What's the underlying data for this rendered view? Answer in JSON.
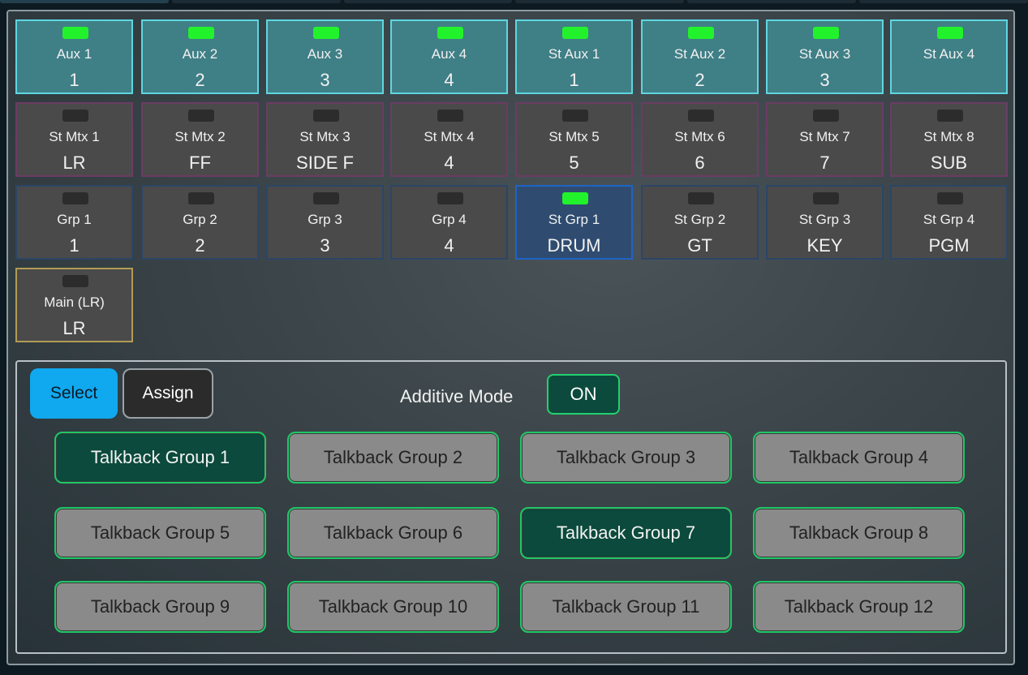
{
  "buses": {
    "aux": [
      {
        "name": "Aux 1",
        "value": "1",
        "active": true
      },
      {
        "name": "Aux 2",
        "value": "2",
        "active": true
      },
      {
        "name": "Aux 3",
        "value": "3",
        "active": true
      },
      {
        "name": "Aux 4",
        "value": "4",
        "active": true
      },
      {
        "name": "St Aux 1",
        "value": "1",
        "active": true
      },
      {
        "name": "St Aux 2",
        "value": "2",
        "active": true
      },
      {
        "name": "St Aux 3",
        "value": "3",
        "active": true
      },
      {
        "name": "St Aux 4",
        "value": "",
        "active": true
      }
    ],
    "matrix": [
      {
        "name": "St Mtx 1",
        "value": "LR",
        "active": false
      },
      {
        "name": "St Mtx 2",
        "value": "FF",
        "active": false
      },
      {
        "name": "St Mtx 3",
        "value": "SIDE F",
        "active": false
      },
      {
        "name": "St Mtx 4",
        "value": "4",
        "active": false
      },
      {
        "name": "St Mtx 5",
        "value": "5",
        "active": false
      },
      {
        "name": "St Mtx 6",
        "value": "6",
        "active": false
      },
      {
        "name": "St Mtx 7",
        "value": "7",
        "active": false
      },
      {
        "name": "St Mtx 8",
        "value": "SUB",
        "active": false
      }
    ],
    "groups": [
      {
        "name": "Grp 1",
        "value": "1",
        "active": false
      },
      {
        "name": "Grp 2",
        "value": "2",
        "active": false
      },
      {
        "name": "Grp 3",
        "value": "3",
        "active": false
      },
      {
        "name": "Grp 4",
        "value": "4",
        "active": false
      },
      {
        "name": "St Grp 1",
        "value": "DRUM",
        "active": true
      },
      {
        "name": "St Grp 2",
        "value": "GT",
        "active": false
      },
      {
        "name": "St Grp 3",
        "value": "KEY",
        "active": false
      },
      {
        "name": "St Grp 4",
        "value": "PGM",
        "active": false
      }
    ],
    "main": [
      {
        "name": "Main (LR)",
        "value": "LR",
        "active": false
      }
    ]
  },
  "controls": {
    "select_label": "Select",
    "assign_label": "Assign",
    "additive_label": "Additive Mode",
    "additive_value": "ON"
  },
  "talkback": [
    {
      "label": "Talkback Group 1",
      "active": true
    },
    {
      "label": "Talkback Group 2",
      "active": false
    },
    {
      "label": "Talkback Group 3",
      "active": false
    },
    {
      "label": "Talkback Group 4",
      "active": false
    },
    {
      "label": "Talkback Group 5",
      "active": false
    },
    {
      "label": "Talkback Group 6",
      "active": false
    },
    {
      "label": "Talkback Group 7",
      "active": true
    },
    {
      "label": "Talkback Group 8",
      "active": false
    },
    {
      "label": "Talkback Group 9",
      "active": false
    },
    {
      "label": "Talkback Group 10",
      "active": false
    },
    {
      "label": "Talkback Group 11",
      "active": false
    },
    {
      "label": "Talkback Group 12",
      "active": false
    }
  ],
  "colors": {
    "led_on": "#22f22c",
    "aux_border": "#5fd6e0",
    "matrix_border": "#6b3c63",
    "group_border": "#2c4566",
    "group_selected": "#1e63c6",
    "main_border": "#b29b55",
    "select_accent": "#10a8ee",
    "talkback_on": "#0b4a3c",
    "talkback_border": "#1fc866"
  }
}
